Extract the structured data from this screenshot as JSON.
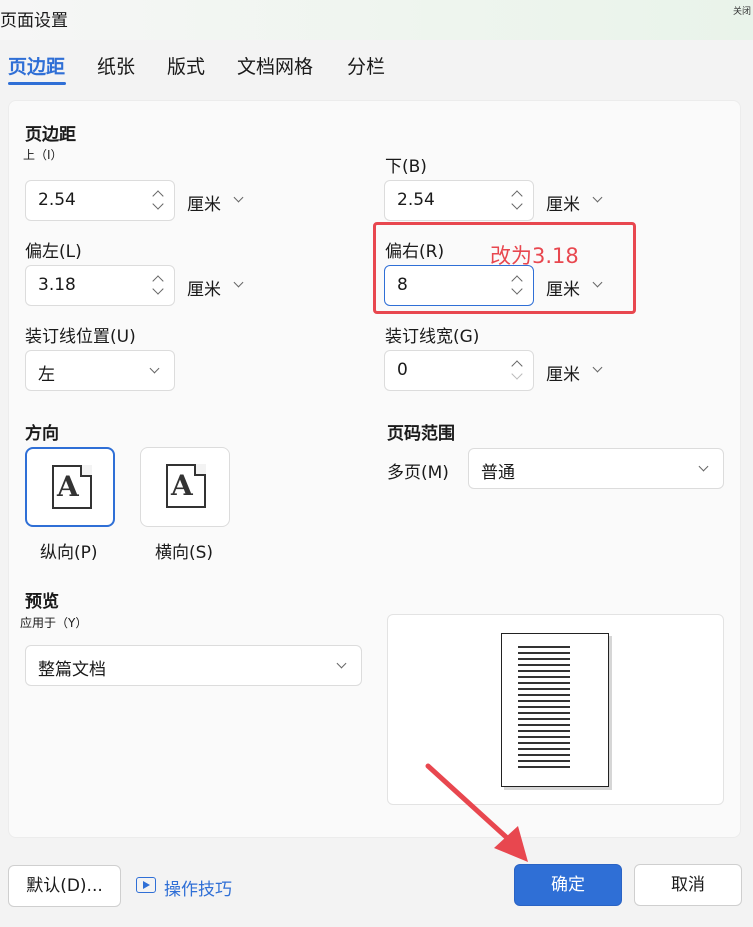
{
  "window": {
    "title": "页面设置",
    "close_label": "关闭"
  },
  "tabs": [
    {
      "label": "页边距",
      "active": true
    },
    {
      "label": "纸张"
    },
    {
      "label": "版式"
    },
    {
      "label": "文档网格"
    },
    {
      "label": "分栏"
    }
  ],
  "margins": {
    "section_title": "页边距",
    "top": {
      "label": "上（I）",
      "value": "2.54",
      "unit": "厘米"
    },
    "bottom": {
      "label": "下(B)",
      "value": "2.54",
      "unit": "厘米"
    },
    "left": {
      "label": "偏左(L)",
      "value": "3.18",
      "unit": "厘米"
    },
    "right": {
      "label": "偏右(R)",
      "value": "8",
      "unit": "厘米"
    },
    "gutter_position": {
      "label": "装订线位置(U)",
      "value": "左"
    },
    "gutter_width": {
      "label": "装订线宽(G)",
      "value": "0",
      "unit": "厘米"
    }
  },
  "orientation": {
    "section_title": "方向",
    "portrait": {
      "label": "纵向(P)",
      "selected": true
    },
    "landscape": {
      "label": "横向(S)"
    },
    "icon_letter": "A"
  },
  "page_range": {
    "section_title": "页码范围",
    "multiple_pages_label": "多页(M)",
    "value": "普通"
  },
  "preview": {
    "section_title": "预览",
    "apply_to_label": "应用于（Y）",
    "apply_to_value": "整篇文档"
  },
  "annotation": {
    "text": "改为3.18",
    "color": "#e8474f"
  },
  "footer": {
    "default_button": "默认(D)...",
    "tips_link": "操作技巧",
    "ok_button": "确定",
    "cancel_button": "取消"
  },
  "colors": {
    "accent": "#2f6fd6",
    "annotation": "#e8474f"
  }
}
